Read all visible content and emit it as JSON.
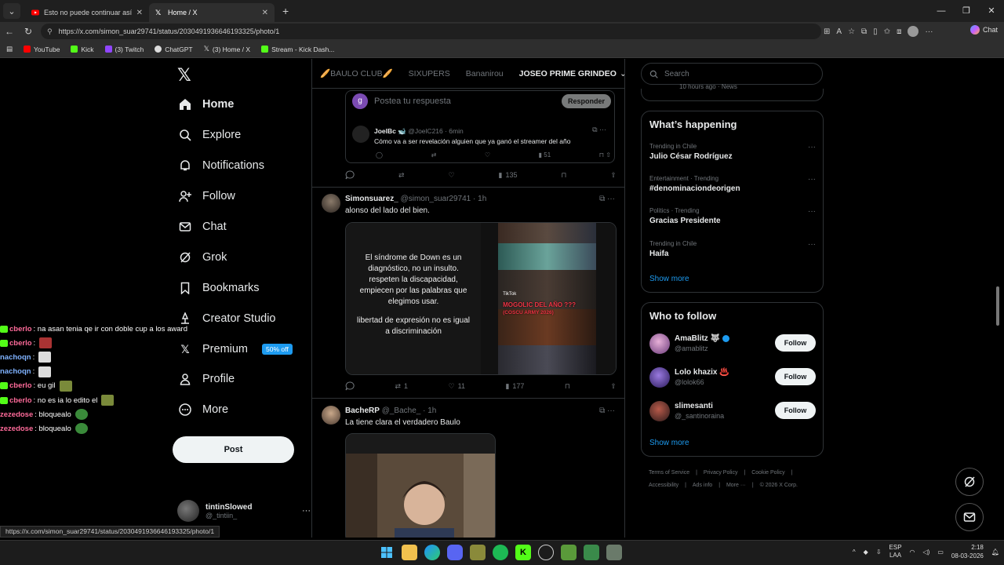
{
  "browser": {
    "tabs": [
      {
        "title": "Esto no puede continuar así. - You",
        "icon": "youtube-icon",
        "active": false
      },
      {
        "title": "Home / X",
        "icon": "x-logo-icon",
        "active": true
      }
    ],
    "url": "https://x.com/simon_suar29741/status/2030491936646193325/photo/1",
    "chat_label": "Chat",
    "bookmarks": [
      {
        "label": "YouTube",
        "color": "#ff0000"
      },
      {
        "label": "Kick",
        "color": "#53fc18"
      },
      {
        "label": "(3) Twitch",
        "color": "#9146ff"
      },
      {
        "label": "ChatGPT",
        "color": "#dddddd"
      },
      {
        "label": "(3) Home / X",
        "color": "#ffffff"
      },
      {
        "label": "Stream - Kick Dash...",
        "color": "#53fc18"
      }
    ]
  },
  "nav": {
    "items": [
      {
        "label": "Home",
        "icon": "home-icon"
      },
      {
        "label": "Explore",
        "icon": "search-icon"
      },
      {
        "label": "Notifications",
        "icon": "bell-icon"
      },
      {
        "label": "Follow",
        "icon": "add-person-icon"
      },
      {
        "label": "Chat",
        "icon": "mail-icon"
      },
      {
        "label": "Grok",
        "icon": "grok-icon"
      },
      {
        "label": "Bookmarks",
        "icon": "bookmark-icon"
      },
      {
        "label": "Creator Studio",
        "icon": "creator-icon"
      },
      {
        "label": "Premium",
        "icon": "x-logo-icon",
        "badge": "50% off"
      },
      {
        "label": "Profile",
        "icon": "person-icon"
      },
      {
        "label": "More",
        "icon": "more-circle-icon"
      }
    ],
    "post_label": "Post",
    "account": {
      "name": "tintinSlowed",
      "handle": "@_tintiin_"
    }
  },
  "timeline": {
    "tabs": [
      "🥖BAULO CLUB🥖",
      "SIXUPERS",
      "Bananirou",
      "JOSEO PRIME GRINDEO"
    ],
    "active_tab": "JOSEO PRIME GRINDEO",
    "reply": {
      "avatar_letter": "g",
      "placeholder": "Postea tu respuesta",
      "button": "Responder"
    },
    "quoted": {
      "name": "JoelBc 🐋",
      "handle_time": "@JoelC216 · 6min",
      "text": "Cómo va a ser revelación alguien que ya ganó el streamer del año",
      "views": "51"
    },
    "first_actions": {
      "views": "135"
    },
    "tweets": [
      {
        "name": "Simonsuarez_",
        "handle_time": "@simon_suar29741 · 1h",
        "text": "alonso del lado del bien.",
        "image_text_1": "El síndrome de Down es un diagnóstico, no un insulto. respeten la discapacidad, empiecen por las palabras que elegimos usar.",
        "image_text_2": "libertad de expresión no es igual a discriminación",
        "video_caption": "MOGOLIC DEL AÑO ???",
        "video_subcaption": "(COSCU ARMY 2026)",
        "tiktok_label": "TikTok",
        "retweets": "1",
        "likes": "11",
        "views": "177"
      },
      {
        "name": "BacheRP",
        "handle_time": "@_Bache_ · 1h",
        "text": "La tiene clara el verdadero Baulo"
      }
    ]
  },
  "sidebar": {
    "search_placeholder": "Search",
    "top_fragment": "10 hours ago · News",
    "whats_happening": "What’s happening",
    "trends": [
      {
        "context": "Trending in Chile",
        "name": "Julio César Rodríguez"
      },
      {
        "context": "Entertainment · Trending",
        "name": "#denominaciondeorigen"
      },
      {
        "context": "Politics · Trending",
        "name": "Gracias Presidente"
      },
      {
        "context": "Trending in Chile",
        "name": "Haifa"
      }
    ],
    "show_more": "Show more",
    "who_to_follow": "Who to follow",
    "follow_suggestions": [
      {
        "name": "AmaBlitz 🐺",
        "handle": "@amablitz",
        "verified": true,
        "button": "Follow"
      },
      {
        "name": "Lolo khazix ♨️",
        "handle": "@lolok66",
        "verified": false,
        "button": "Follow"
      },
      {
        "name": "slimesanti",
        "handle": "@_santinoraina",
        "verified": false,
        "button": "Follow"
      }
    ],
    "show_more_2": "Show more",
    "footer": [
      "Terms of Service",
      "Privacy Policy",
      "Cookie Policy",
      "Accessibility",
      "Ads info",
      "More ···",
      "© 2026 X Corp."
    ]
  },
  "stream_chat": [
    {
      "user": "cberlo",
      "color": "#ff6b9a",
      "msg": ": na asan tenia qe ir con doble cup a los award"
    },
    {
      "user": "cberlo",
      "color": "#ff6b9a",
      "msg": ":"
    },
    {
      "user": "nachoqn",
      "color": "#7fb2ff",
      "msg": ":"
    },
    {
      "user": "nachoqn",
      "color": "#7fb2ff",
      "msg": ":"
    },
    {
      "user": "cberlo",
      "color": "#ff6b9a",
      "msg": ": eu gil"
    },
    {
      "user": "cberlo",
      "color": "#ff6b9a",
      "msg": ": no es ia lo edito el"
    },
    {
      "user": "zezedose",
      "color": "#ff6b9a",
      "msg": ": bloquealo"
    },
    {
      "user": "zezedose",
      "color": "#ff6b9a",
      "msg": ": bloquealo"
    }
  ],
  "status_url": "https://x.com/simon_suar29741/status/2030491936646193325/photo/1",
  "taskbar": {
    "lang": "ESP",
    "lang_sub": "LAA",
    "time": "2:18",
    "date": "08-03-2026"
  }
}
